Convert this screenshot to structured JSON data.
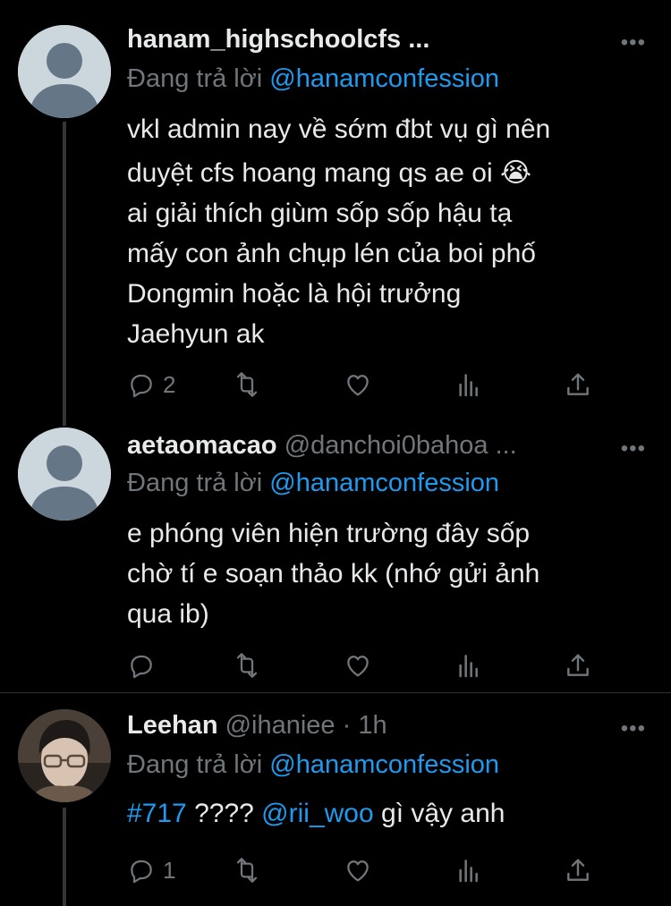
{
  "reply_prefix": "Đang trả lời",
  "tweets": [
    {
      "name": "hanam_highschoolcfs ...",
      "handle": "",
      "time": "",
      "reply_to": "@hanamconfession",
      "lines": [
        "vkl admin nay về sớm đbt vụ gì nên",
        "duyệt cfs hoang mang qs ae oi 😭",
        "ai giải thích giùm sốp sốp hậu tạ",
        "mấy con ảnh chụp lén của boi phố",
        "Dongmin hoặc là hội trưởng",
        "Jaehyun ak"
      ],
      "reply_count": "2",
      "retweet_count": "",
      "like_count": ""
    },
    {
      "name": "aetaomacao",
      "handle": "@danchoi0bahoa ...",
      "time": "",
      "reply_to": "@hanamconfession",
      "lines": [
        "e phóng viên hiện trường đây sốp",
        "chờ tí e soạn thảo kk (nhớ gửi ảnh",
        "qua ib)"
      ],
      "reply_count": "",
      "retweet_count": "",
      "like_count": ""
    },
    {
      "name": "Leehan",
      "handle": "@ihaniee · 1h",
      "time": "",
      "reply_to": "@hanamconfession",
      "body_parts": {
        "hashtag": "#717",
        "text1": " ???? ",
        "mention": "@rii_woo",
        "text2": " gì vậy anh"
      },
      "reply_count": "1",
      "retweet_count": "",
      "like_count": ""
    }
  ],
  "icons": {
    "more": "more-dots-icon",
    "reply": "reply-bubble-icon",
    "retweet": "retweet-icon",
    "like": "heart-icon",
    "views": "analytics-bars-icon",
    "share": "share-upload-icon"
  },
  "colors": {
    "background": "#000000",
    "text": "#e7e9ea",
    "muted": "#71767b",
    "link": "#1d9bf0",
    "divider": "#2f3336"
  }
}
